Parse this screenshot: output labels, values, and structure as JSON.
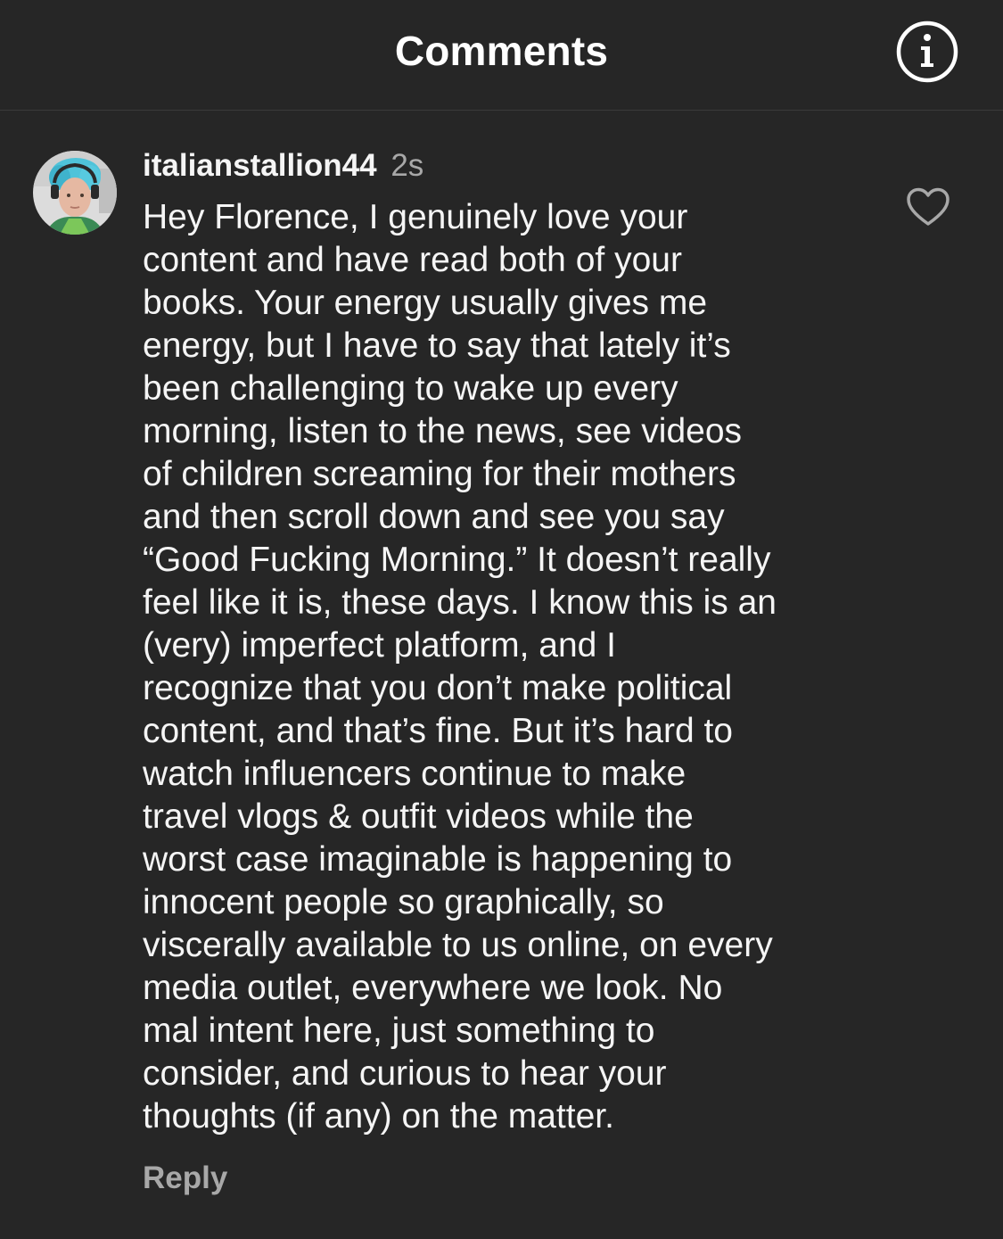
{
  "header": {
    "title": "Comments",
    "info_icon": "info-icon"
  },
  "comment": {
    "avatar_icon": "user-avatar",
    "username": "italianstallion44",
    "timestamp": "2s",
    "text": "Hey Florence, I genuinely love your\ncontent and have read both of your\nbooks. Your energy usually gives me\nenergy, but I have to say that lately it’s\nbeen challenging to wake up every\nmorning, listen to the news, see videos\nof children screaming for their mothers\nand then scroll down and see you say\n“Good Fucking Morning.” It doesn’t really\nfeel like it is, these days. I know this is an\n(very) imperfect platform, and I\nrecognize that you don’t make political\ncontent, and that’s fine. But it’s hard to\nwatch influencers continue to make\ntravel vlogs & outfit videos while the\nworst case imaginable is happening to\ninnocent people so graphically, so\nviscerally available to us online, on every\nmedia outlet, everywhere we look. No\nmal intent here, just something to\nconsider, and curious to hear your\nthoughts (if any) on the matter.",
    "reply_label": "Reply",
    "like_icon": "heart-outline-icon"
  },
  "colors": {
    "background": "#262626",
    "text_primary": "#f5f5f5",
    "text_secondary": "#a8a8a8",
    "divider": "#3a3a3a",
    "avatar_hair": "#4fc3d9"
  }
}
